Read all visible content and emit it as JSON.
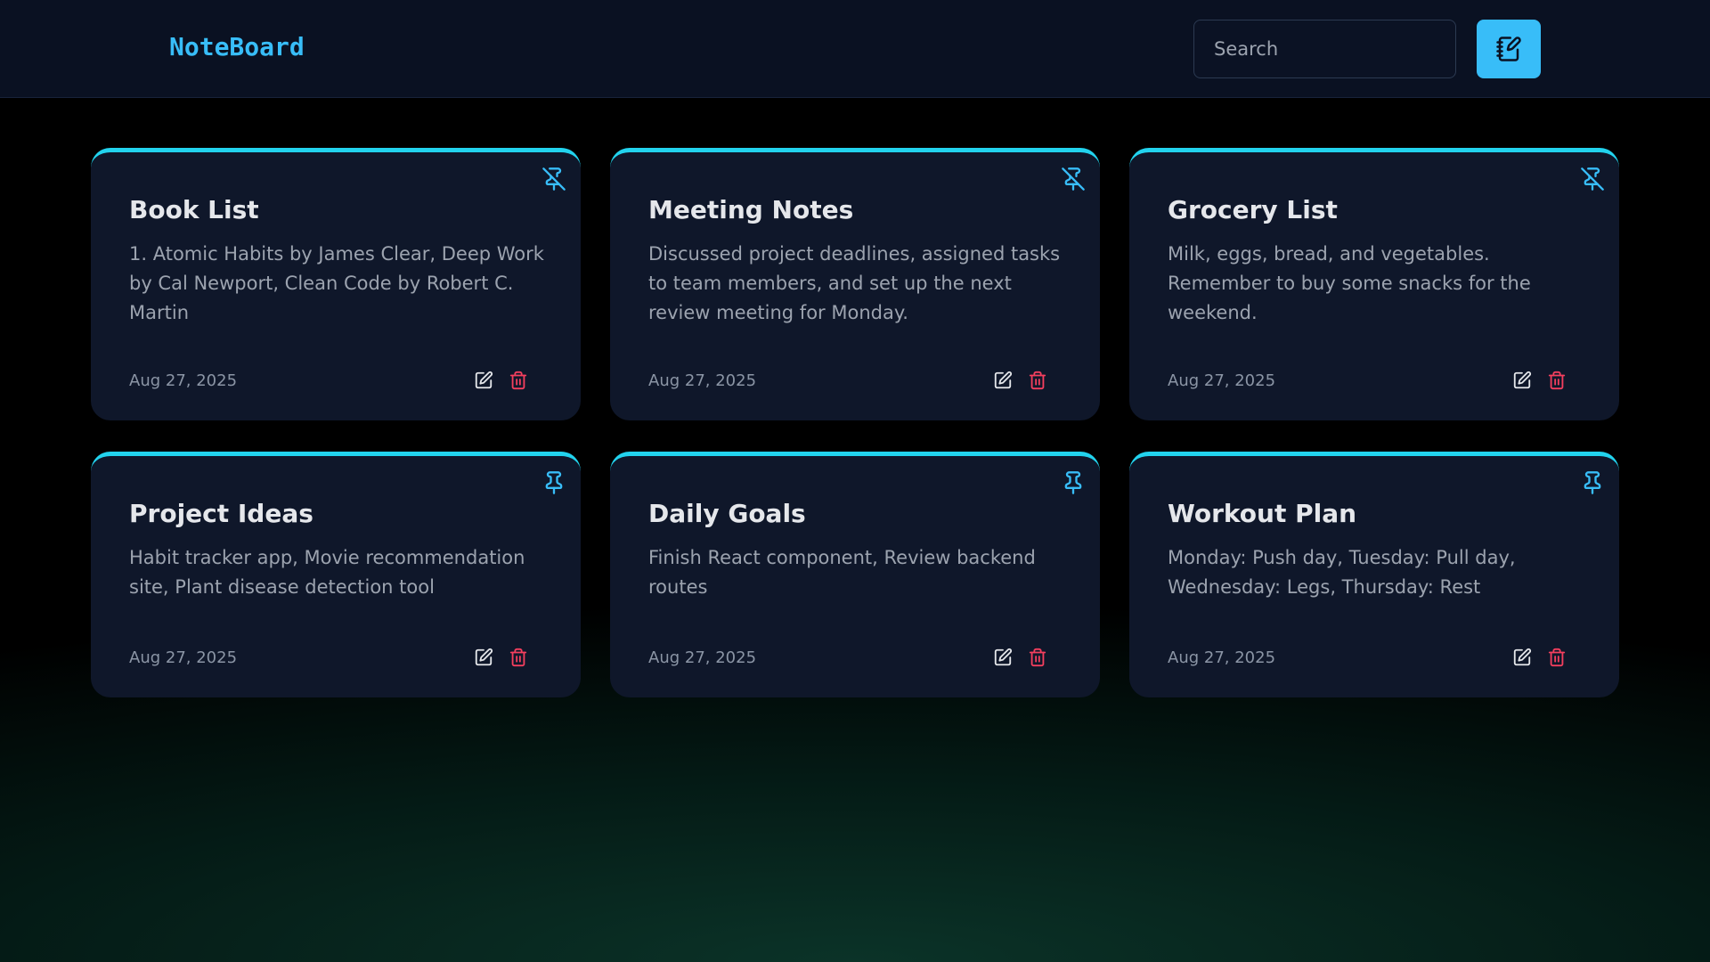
{
  "header": {
    "brand": "NoteBoard",
    "search_placeholder": "Search",
    "new_note_icon": "notebook-pen-icon"
  },
  "notes": [
    {
      "title": "Book List",
      "body": "1. Atomic Habits by James Clear, Deep Work by Cal Newport, Clean Code by Robert C. Martin",
      "date": "Aug 27, 2025",
      "pinned": true
    },
    {
      "title": "Meeting Notes",
      "body": "Discussed project deadlines, assigned tasks to team members, and set up the next review meeting for Monday.",
      "date": "Aug 27, 2025",
      "pinned": true
    },
    {
      "title": "Grocery List",
      "body": "Milk, eggs, bread, and vegetables. Remember to buy some snacks for the weekend.",
      "date": "Aug 27, 2025",
      "pinned": true
    },
    {
      "title": "Project Ideas",
      "body": "Habit tracker app, Movie recommendation site, Plant disease detection tool",
      "date": "Aug 27, 2025",
      "pinned": false
    },
    {
      "title": "Daily Goals",
      "body": "Finish React component, Review backend routes",
      "date": "Aug 27, 2025",
      "pinned": false
    },
    {
      "title": "Workout Plan",
      "body": "Monday: Push day, Tuesday: Pull day, Wednesday: Legs, Thursday: Rest",
      "date": "Aug 27, 2025",
      "pinned": false
    }
  ],
  "colors": {
    "accent": "#38bdf8",
    "card_border": "#22d3ee",
    "card_bg": "#0f172a",
    "delete": "#f43f5e"
  }
}
